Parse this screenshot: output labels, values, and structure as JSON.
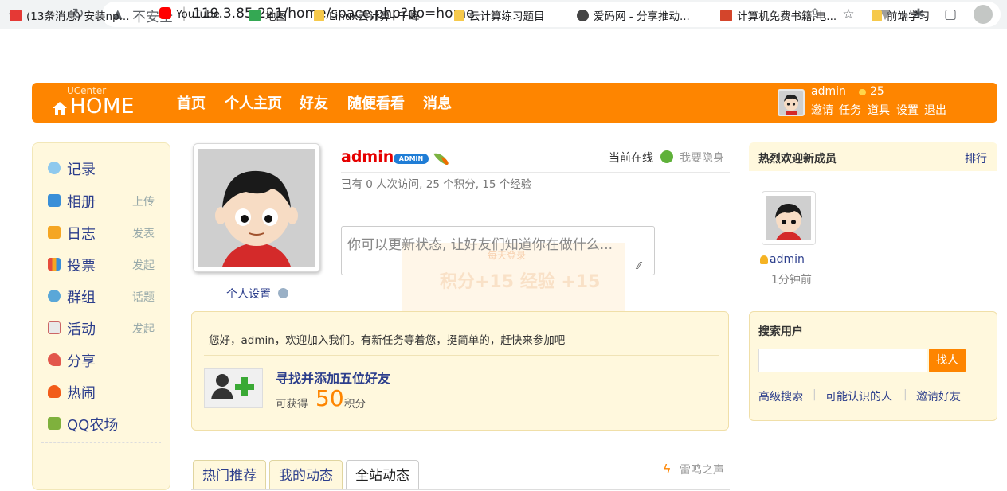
{
  "browser": {
    "url_security": "不安全",
    "url": "119.3.85.221/home/space.php?do=home",
    "bookmarks": [
      {
        "label": "(13条消息) 安装np...",
        "icon": "csdn-icon",
        "color": "#e53935"
      },
      {
        "label": "YouTube",
        "icon": "youtube-icon",
        "color": "#ff0000"
      },
      {
        "label": "地图",
        "icon": "maps-icon",
        "color": "#34a853"
      },
      {
        "label": "Linux云计算--千峰",
        "icon": "folder-icon",
        "color": "#f6c94b"
      },
      {
        "label": "云计算练习题目",
        "icon": "folder-icon",
        "color": "#f6c94b"
      },
      {
        "label": "爱码网 - 分享推动...",
        "icon": "globe-icon",
        "color": "#444444"
      },
      {
        "label": "计算机免费书籍,电...",
        "icon": "book-icon",
        "color": "#d4452b"
      },
      {
        "label": "前端学习",
        "icon": "folder-icon",
        "color": "#f6c94b"
      }
    ]
  },
  "header": {
    "logo_small": "UCenter",
    "logo_big": "HOME",
    "nav": [
      "首页",
      "个人主页",
      "好友",
      "随便看看",
      "消息"
    ],
    "username": "admin",
    "score": "25",
    "links": [
      "邀请",
      "任务",
      "道具",
      "设置",
      "退出"
    ],
    "brand_color": "#fe8500"
  },
  "sidebar": {
    "items": [
      {
        "label": "记录",
        "action": "",
        "icon": "record-icon"
      },
      {
        "label": "相册",
        "action": "上传",
        "icon": "album-icon"
      },
      {
        "label": "日志",
        "action": "发表",
        "icon": "blog-icon"
      },
      {
        "label": "投票",
        "action": "发起",
        "icon": "poll-icon"
      },
      {
        "label": "群组",
        "action": "话题",
        "icon": "group-icon"
      },
      {
        "label": "活动",
        "action": "发起",
        "icon": "event-icon"
      },
      {
        "label": "分享",
        "action": "",
        "icon": "share-icon"
      },
      {
        "label": "热闹",
        "action": "",
        "icon": "hot-icon"
      },
      {
        "label": "QQ农场",
        "action": "",
        "icon": "farm-icon"
      }
    ]
  },
  "profile": {
    "name": "admin",
    "badge": "ADMIN",
    "online_label": "当前在线",
    "hide_label": "我要隐身",
    "stats": "已有 0 人次访问, 25 个积分, 15 个经验",
    "status_placeholder": "你可以更新状态, 让好友们知道你在做什么...",
    "settings_link": "个人设置",
    "ghost_title": "每天登录",
    "ghost_text": "积分+15 经验 +15"
  },
  "task": {
    "greeting": "您好，admin，欢迎加入我们。有新任务等着您，挺简单的，赶快来参加吧",
    "title": "寻找并添加五位好友",
    "reward_prefix": "可获得",
    "reward_value": "50",
    "reward_suffix": "积分"
  },
  "feed_tabs": [
    "热门推荐",
    "我的动态",
    "全站动态"
  ],
  "feed_extra": "雷鸣之声",
  "welcome": {
    "title": "热烈欢迎新成员",
    "rank_link": "排行",
    "member_name": "admin",
    "member_time": "1分钟前"
  },
  "search": {
    "title": "搜索用户",
    "button": "找人",
    "links": [
      "高级搜索",
      "可能认识的人",
      "邀请好友"
    ]
  }
}
